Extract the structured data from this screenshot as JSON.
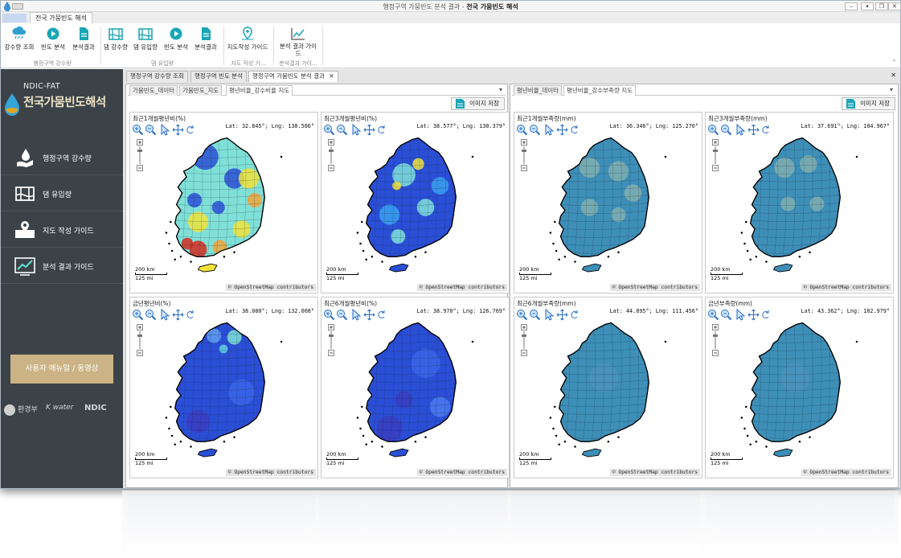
{
  "window": {
    "title_prefix": "행정구역 가뭄빈도 분석 결과 - ",
    "title_bold": "전국 가뭄빈도 해석"
  },
  "ribbon": {
    "tab": "전국 가뭄빈도 해석",
    "buttons": [
      {
        "label": "강수량 조회",
        "icon": "rain-cloud-icon"
      },
      {
        "label": "빈도 분석",
        "icon": "play-icon"
      },
      {
        "label": "분석결과",
        "icon": "document-icon"
      },
      {
        "label": "댐 강수량",
        "icon": "dam-icon"
      },
      {
        "label": "댐 유입량",
        "icon": "dam-icon"
      },
      {
        "label": "빈도 분석",
        "icon": "play-icon"
      },
      {
        "label": "분석결과",
        "icon": "document-icon"
      },
      {
        "label": "지도작성 가이드",
        "icon": "map-pin-icon"
      },
      {
        "label": "분석 결과 가이드",
        "icon": "chart-icon"
      }
    ],
    "groups": [
      "행정구역 강수량",
      "댐 유입량",
      "지도 작성 가...",
      "분석결과 가이..."
    ]
  },
  "sidebar": {
    "logo_top": "NDIC-FAT",
    "logo_main": "전국가뭄빈도해석",
    "items": [
      {
        "label": "행정구역 강수량"
      },
      {
        "label": "댐 유입량"
      },
      {
        "label": "지도 작성 가이드"
      },
      {
        "label": "분석 결과 가이드"
      }
    ],
    "manual_button": "사용자 매뉴얼 / 동영상",
    "footer": [
      "환경부",
      "K water",
      "NDIC"
    ]
  },
  "doc_tabs": [
    "행정구역 강수량 조회",
    "행정구역 빈도 분석",
    "행정구역 가뭄빈도 분석 결과"
  ],
  "left_pane": {
    "tabs": [
      "가뭄빈도_데이터",
      "가뭄빈도_지도",
      "평년비율_강수비율 지도"
    ],
    "save": "이미지 저장",
    "panels": [
      {
        "title": "최근1개월평년비(%)",
        "coord": "Lat: 32.845°; Lng: 130.506°",
        "scheme": "jet1"
      },
      {
        "title": "최근3개월평년비(%)",
        "coord": "Lat: 38.577°; Lng: 130.379°",
        "scheme": "jet3"
      },
      {
        "title": "금년평년비(%)",
        "coord": "Lat: 38.080°; Lng: 132.008°",
        "scheme": "blue"
      },
      {
        "title": "최근6개월평년비(%)",
        "coord": "Lat: 38.970°; Lng: 126.769°",
        "scheme": "blue6"
      }
    ]
  },
  "right_pane": {
    "tabs": [
      "평년비율_데이터",
      "평년비율_강수부족량 지도"
    ],
    "save": "이미지 저장",
    "panels": [
      {
        "title": "최근1개월부족량(mm)",
        "coord": "Lat: 36.346°; Lng: 125.270°",
        "scheme": "teal1"
      },
      {
        "title": "최근3개월부족량(mm)",
        "coord": "Lat: 37.691°; Lng: 104.967°",
        "scheme": "teal3"
      },
      {
        "title": "최근6개월부족량(mm)",
        "coord": "Lat: 44.895°; Lng: 111.456°",
        "scheme": "teal"
      },
      {
        "title": "금년부족량(mm)",
        "coord": "Lat: 43.362°; Lng: 102.979°",
        "scheme": "teal"
      }
    ]
  },
  "map_common": {
    "scale_km": "200 km",
    "scale_mi": "125 mi",
    "attribution_symbol": "©",
    "attribution": "OpenStreetMap contributors"
  },
  "colors": {
    "sidebar_bg": "#3b4348",
    "accent_gold": "#cbb385",
    "map_blue": "#2a4fd6",
    "map_teal": "#3d8fb8",
    "map_red": "#d42a1e",
    "map_yellow": "#f1e33a",
    "map_cyan": "#7fe0d8"
  }
}
